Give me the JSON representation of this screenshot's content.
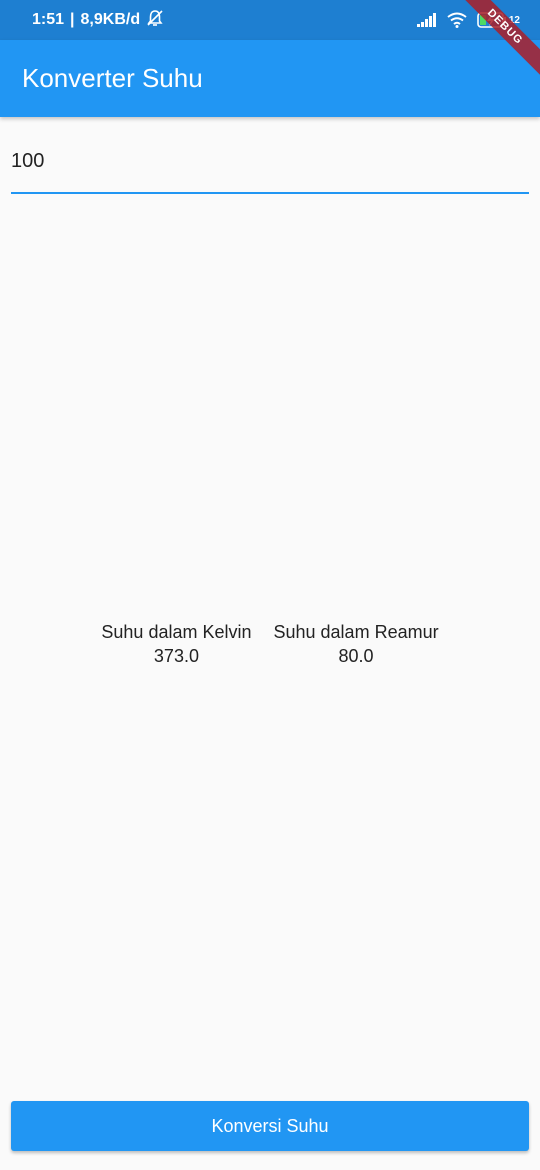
{
  "status_bar": {
    "time": "1:51",
    "separator": "|",
    "network_speed": "8,9KB/d",
    "battery_level": "12",
    "icons": [
      "alarm-off-icon",
      "signal-icon",
      "wifi-icon",
      "battery-charging-icon"
    ]
  },
  "debug_banner": "DEBUG",
  "app_bar": {
    "title": "Konverter Suhu"
  },
  "input": {
    "value": "100",
    "placeholder": ""
  },
  "results": {
    "kelvin_label": "Suhu dalam Kelvin",
    "kelvin_value": "373.0",
    "reamur_label": "Suhu dalam Reamur",
    "reamur_value": "80.0"
  },
  "button": {
    "label": "Konversi Suhu"
  },
  "colors": {
    "primary": "#2196f3",
    "status_bar": "#1e7fd1",
    "background": "#fafafa"
  }
}
